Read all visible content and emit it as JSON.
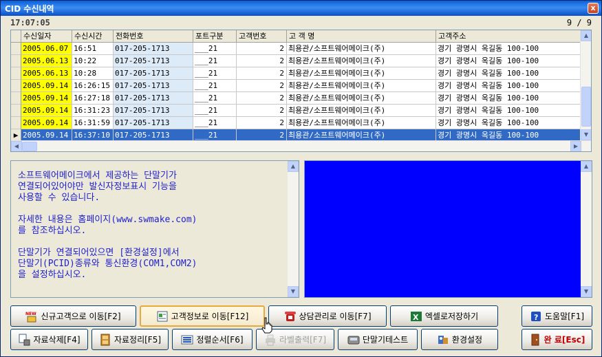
{
  "window": {
    "title": "CID 수신내역",
    "close_glyph": "x"
  },
  "status": {
    "time": "17:07:05",
    "page_count": "9 / 9"
  },
  "grid": {
    "columns": [
      "수신일자",
      "수신시간",
      "전화번호",
      "포트구분",
      "고객번호",
      "고 객 명",
      "고객주소"
    ],
    "rows": [
      [
        "2005.06.07",
        "16:51",
        "017-205-1713",
        "___21",
        "2",
        "최용관/소프트웨어메이크(주)",
        "경기 광명시 옥길동 100-100"
      ],
      [
        "2005.06.13",
        "10:22",
        "017-205-1713",
        "___21",
        "2",
        "최용관/소프트웨어메이크(주)",
        "경기 광명시 옥길동 100-100"
      ],
      [
        "2005.06.13",
        "10:28",
        "017-205-1713",
        "___21",
        "2",
        "최용관/소프트웨어메이크(주)",
        "경기 광명시 옥길동 100-100"
      ],
      [
        "2005.09.14",
        "16:26:15",
        "017-205-1713",
        "___21",
        "2",
        "최용관/소프트웨어메이크(주)",
        "경기 광명시 옥길동 100-100"
      ],
      [
        "2005.09.14",
        "16:27:18",
        "017-205-1713",
        "___21",
        "2",
        "최용관/소프트웨어메이크(주)",
        "경기 광명시 옥길동 100-100"
      ],
      [
        "2005.09.14",
        "16:31:23",
        "017-205-1713",
        "___21",
        "2",
        "최용관/소프트웨어메이크(주)",
        "경기 광명시 옥길동 100-100"
      ],
      [
        "2005.09.14",
        "16:31:59",
        "017-205-1713",
        "___21",
        "2",
        "최용관/소프트웨어메이크(주)",
        "경기 광명시 옥길동 100-100"
      ],
      [
        "2005.09.14",
        "16:37:10",
        "017-205-1713",
        "___21",
        "2",
        "최용관/소프트웨어메이크(주)",
        "경기 광명시 옥길동 100-100"
      ]
    ],
    "selected_row": 7,
    "row_indicator": "▶"
  },
  "message": "소프트웨어메이크에서 제공하는 단말기가\n연결되어있어야만 발신자정보표시 기능을\n사용할 수 있습니다.\n\n자세한 내용은 홈페이지(www.swmake.com)\n를 참조하십시오.\n\n단말기가 연결되어있으면 [환경설정]에서\n단말기(PCID)종류와 통신환경(COM1,COM2)\n을 설정하십시오.",
  "buttons": {
    "new_customer": "신규고객으로 이동[F2]",
    "customer_info": "고객정보로 이동[F12]",
    "consult": "상담관리로 이동[F7]",
    "excel": "엑셀로저장하기",
    "help": "도움말[F1]",
    "delete": "자료삭제[F4]",
    "organize": "자료정리[F5]",
    "sort": "정렬순서[F6]",
    "label_print": "라벨출력[F7]",
    "terminal_test": "단말기테스트",
    "settings": "환경설정",
    "exit": "완 료[Esc]"
  },
  "icons": {
    "new_badge": "NEW",
    "excel_letter": "X"
  },
  "colors": {
    "date_highlight": "#FFFF00",
    "phone_highlight": "#DDEBF9",
    "selection": "#316AC5",
    "message_text": "#2020D0",
    "display_panel": "#0000FF"
  }
}
